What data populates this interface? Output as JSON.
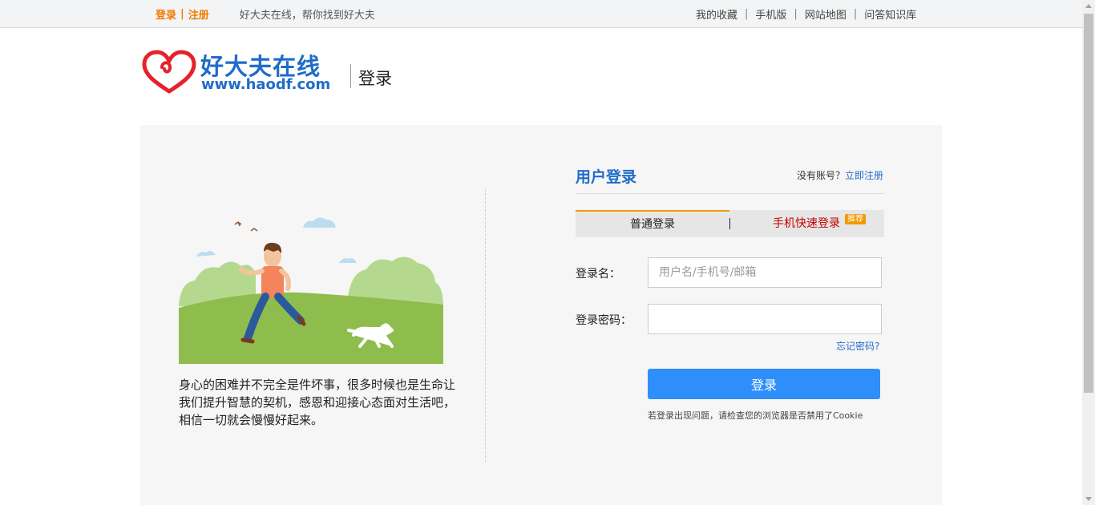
{
  "topbar": {
    "login": "登录",
    "separator": "|",
    "register": "注册",
    "slogan": "好大夫在线，帮你找到好大夫",
    "links": [
      "我的收藏",
      "手机版",
      "网站地图",
      "问答知识库"
    ],
    "pipe": "|"
  },
  "header": {
    "logo_cn": "好大夫在线",
    "logo_url": "www.haodf.com",
    "page_title": "登录"
  },
  "left": {
    "quote": "身心的困难并不完全是件坏事，很多时候也是生命让我们提升智慧的契机，感恩和迎接心态面对生活吧，相信一切就会慢慢好起来。"
  },
  "form": {
    "title": "用户登录",
    "no_account": "没有账号？",
    "register_now": "立即注册",
    "tab_normal": "普通登录",
    "tab_mobile": "手机快速登录",
    "tab_badge": "推荐",
    "username_label": "登录名：",
    "username_placeholder": "用户名/手机号/邮箱",
    "password_label": "登录密码：",
    "forgot": "忘记密码?",
    "login_button": "登录",
    "cookie_hint": "若登录出现问题，请检查您的浏览器是否禁用了Cookie"
  },
  "colors": {
    "brand_blue": "#1f6cc8",
    "accent_orange": "#f39800",
    "button_blue": "#2e8ffa",
    "logo_red": "#e5222b"
  }
}
